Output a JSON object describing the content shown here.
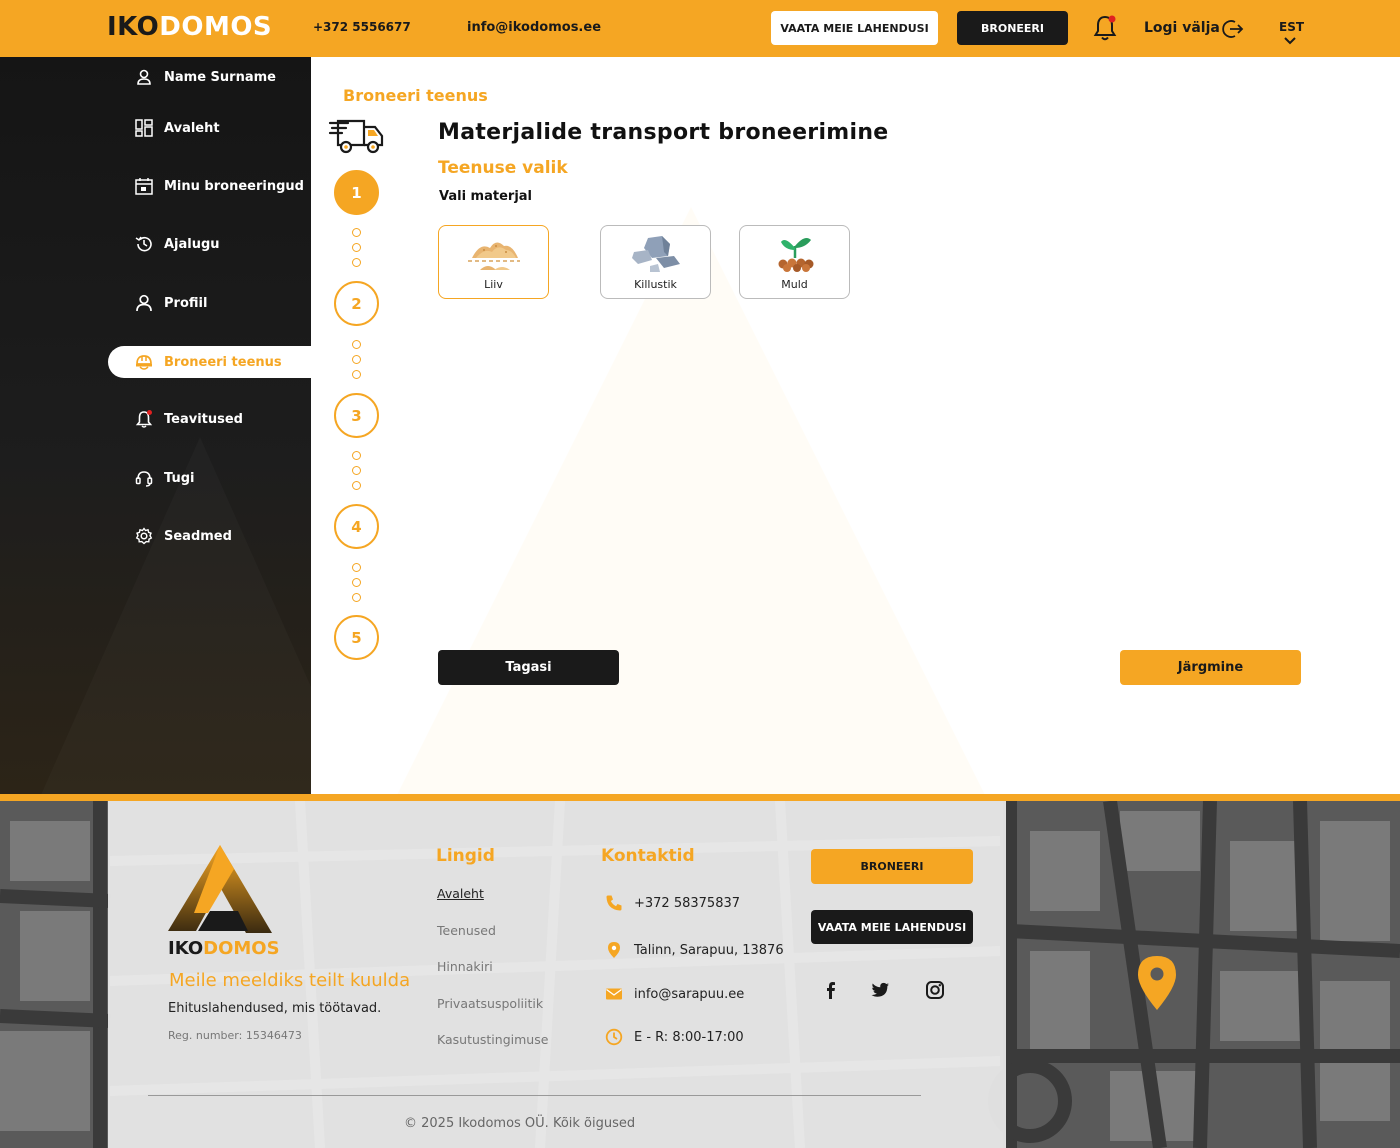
{
  "header": {
    "logo_a": "IKO",
    "logo_b": "DOMOS",
    "phone": "+372 5556677",
    "email": "info@ikodomos.ee",
    "solutions_btn": "VAATA MEIE LAHENDUSI",
    "book_btn": "BRONEERI",
    "logout": "Logi välja",
    "lang": "EST"
  },
  "sidebar": {
    "items": [
      {
        "label": "Name Surname",
        "icon": "user-icon"
      },
      {
        "label": "Avaleht",
        "icon": "dashboard-icon"
      },
      {
        "label": "Minu broneeringud",
        "icon": "calendar-icon"
      },
      {
        "label": "Ajalugu",
        "icon": "history-icon"
      },
      {
        "label": "Profiil",
        "icon": "profile-icon"
      },
      {
        "label": "Broneeri teenus",
        "icon": "helmet-icon",
        "active": true
      },
      {
        "label": "Teavitused",
        "icon": "bell-icon"
      },
      {
        "label": "Tugi",
        "icon": "headset-icon"
      },
      {
        "label": "Seadmed",
        "icon": "gear-icon"
      }
    ]
  },
  "main": {
    "breadcrumb": "Broneeri teenus",
    "title": "Materjalide transport broneerimine",
    "subtitle": "Teenuse valik",
    "pick_label": "Vali materjal",
    "steps": [
      "1",
      "2",
      "3",
      "4",
      "5"
    ],
    "active_step": 1,
    "materials": [
      {
        "label": "Liiv",
        "selected": true
      },
      {
        "label": "Killustik",
        "selected": false
      },
      {
        "label": "Muld",
        "selected": false
      }
    ],
    "back_btn": "Tagasi",
    "next_btn": "Järgmine"
  },
  "footer": {
    "brand_a": "IKO",
    "brand_b": "DOMOS",
    "slogan": "Meile meeldiks teilt kuulda",
    "sub": "Ehituslahendused, mis töötavad.",
    "reg": "Reg. number: 15346473",
    "links_title": "Lingid",
    "links": [
      "Avaleht",
      "Teenused",
      "Hinnakiri",
      "Privaatsuspoliitik",
      "Kasutustingimuse"
    ],
    "contacts_title": "Kontaktid",
    "contacts": [
      {
        "text": "+372 58375837",
        "icon": "phone-icon"
      },
      {
        "text": "Talinn, Sarapuu, 13876",
        "icon": "location-icon"
      },
      {
        "text": "info@sarapuu.ee",
        "icon": "mail-icon"
      },
      {
        "text": "E - R: 8:00-17:00",
        "icon": "clock-icon"
      }
    ],
    "book_btn": "BRONEERI",
    "solutions_btn": "VAATA MEIE LAHENDUSI",
    "copyright": "© 2025 Ikodomos OÜ. Kõik õigused"
  },
  "colors": {
    "accent": "#f5a623",
    "dark": "#1a1a1a"
  }
}
